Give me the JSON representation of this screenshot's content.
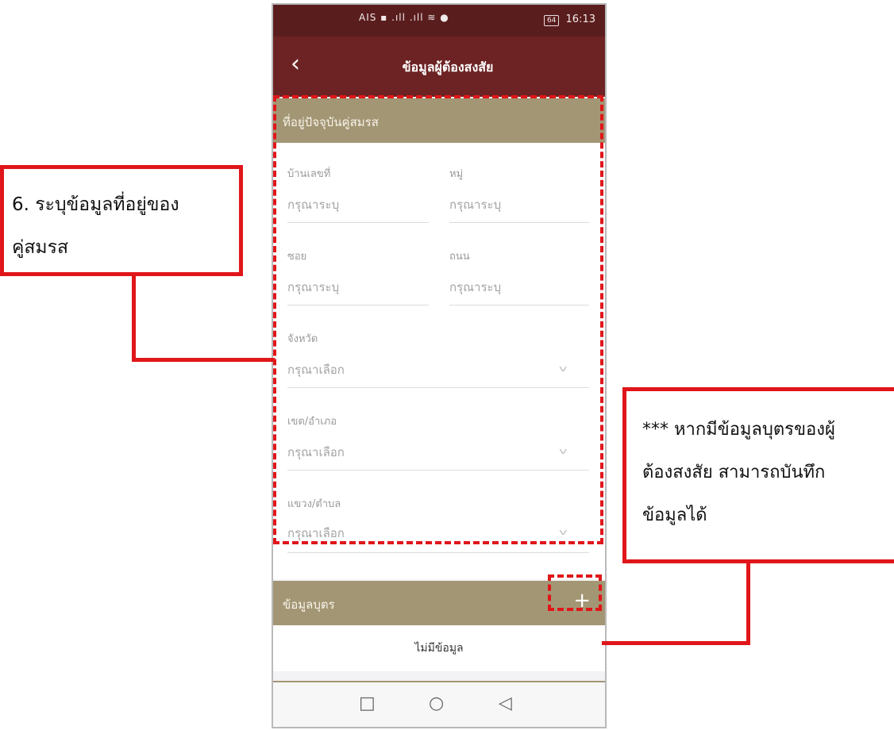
{
  "status_bar": {
    "signal_icons": "AIS ▪ .ıll .ıll ≋ ●",
    "battery": "64",
    "time": "16:13"
  },
  "app_bar": {
    "back_icon": "‹",
    "title": "ข้อมูลผู้ต้องสงสัย"
  },
  "spouse_address": {
    "section_title": "ที่อยู่ปัจจุบันคู่สมรส",
    "fields": {
      "house_no": {
        "label": "บ้านเลขที่",
        "placeholder": "กรุณาระบุ"
      },
      "moo": {
        "label": "หมู่",
        "placeholder": "กรุณาระบุ"
      },
      "soi": {
        "label": "ซอย",
        "placeholder": "กรุณาระบุ"
      },
      "road": {
        "label": "ถนน",
        "placeholder": "กรุณาระบุ"
      },
      "province": {
        "label": "จังหวัด",
        "placeholder": "กรุณาเลือก"
      },
      "district": {
        "label": "เขต/อำเภอ",
        "placeholder": "กรุณาเลือก"
      },
      "subdistrict": {
        "label": "แขวง/ตำบล",
        "placeholder": "กรุณาเลือก"
      }
    }
  },
  "children": {
    "section_title": "ข้อมูลบุตร",
    "add_icon": "+",
    "empty_text": "ไม่มีข้อมูล"
  },
  "nav_bar": {
    "recents": "□",
    "home": "○",
    "back": "◁"
  },
  "annotations": {
    "step6_line1": "6. ระบุข้อมูลที่อยู่ของ",
    "step6_line2": "คู่สมรส",
    "note_line1": "*** หากมีข้อมูลบุตรของผู้",
    "note_line2": "ต้องสงสัย สามารถบันทึก",
    "note_line3": "ข้อมูลได้"
  },
  "colors": {
    "appbar": "#6d2323",
    "section_header": "#a39674",
    "highlight": "#e0161a"
  }
}
